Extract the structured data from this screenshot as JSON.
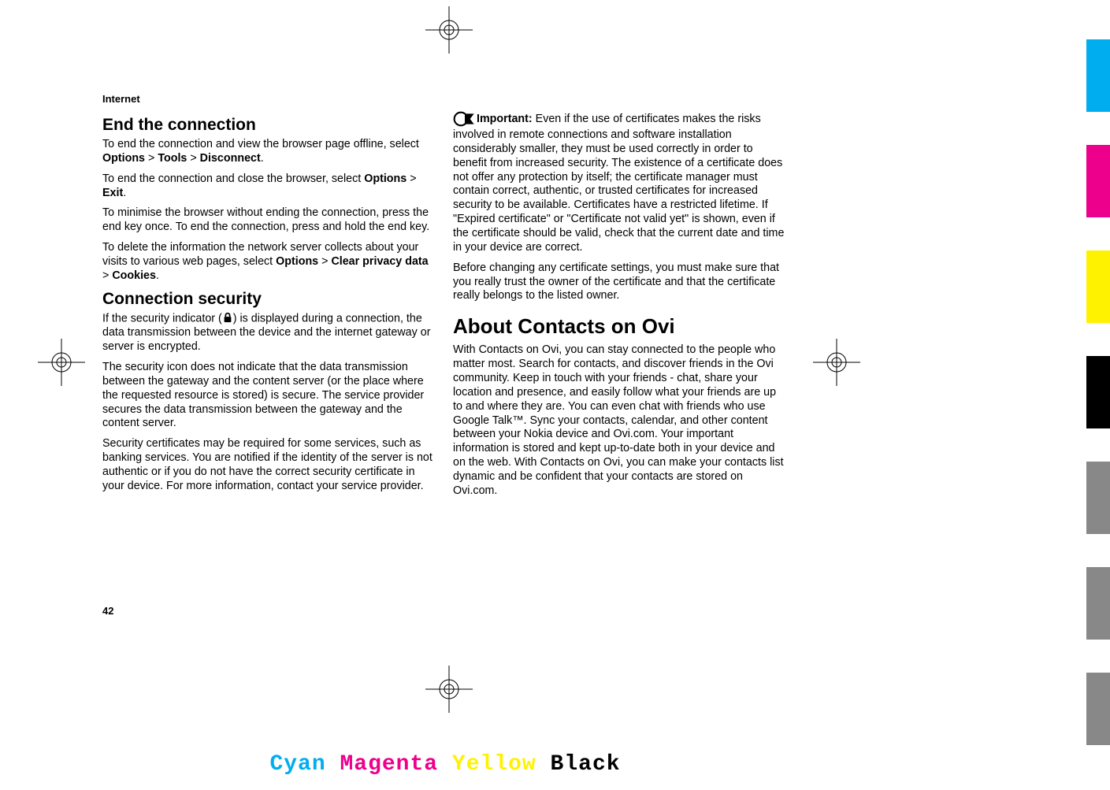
{
  "section": "Internet",
  "pageNumber": "42",
  "left": {
    "heading1": "End the connection",
    "p1a": "To end the connection and view the browser page offline, select ",
    "p1b": "Options",
    "p1c": " > ",
    "p1d": "Tools",
    "p1e": " > ",
    "p1f": "Disconnect",
    "p1g": ".",
    "p2a": "To end the connection and close the browser, select ",
    "p2b": "Options",
    "p2c": " > ",
    "p2d": "Exit",
    "p2e": ".",
    "p3": "To minimise the browser without ending the connection, press the end key once. To end the connection, press and hold the end key.",
    "p4a": "To delete the information the network server collects about your visits to various web pages, select ",
    "p4b": "Options",
    "p4c": " > ",
    "p4d": "Clear privacy data",
    "p4e": " > ",
    "p4f": "Cookies",
    "p4g": ".",
    "heading2": "Connection security",
    "p5a": "If the security indicator (",
    "p5b": ") is displayed during a connection, the data transmission between the device and the internet gateway or server is encrypted.",
    "p6": "The security icon does not indicate that the data transmission between the gateway and the content server (or the place where the requested resource is stored) is secure. The service provider secures the data transmission between the gateway and the content server.",
    "p7": "Security certificates may be required for some services, such as banking services. You are notified if the identity of the server is not authentic or if you do not have the correct security certificate in your device. For more information, contact your service provider."
  },
  "right": {
    "importantLabel": "Important:  ",
    "importantText": "Even if the use of certificates makes the risks involved in remote connections and software installation considerably smaller, they must be used correctly in order to benefit from increased security. The existence of a certificate does not offer any protection by itself; the certificate manager must contain correct, authentic, or trusted certificates for increased security to be available. Certificates have a restricted lifetime. If \"Expired certificate\" or \"Certificate not valid yet\" is shown, even if the certificate should be valid, check that the current date and time in your device are correct.",
    "p2": "Before changing any certificate settings, you must make sure that you really trust the owner of the certificate and that the certificate really belongs to the listed owner.",
    "heading1": "About Contacts on Ovi",
    "p3": "With Contacts on Ovi, you can stay connected to the people who matter most. Search for contacts, and discover friends in the Ovi community. Keep in touch with your friends - chat, share your location and presence, and easily follow what your friends are up to and where they are. You can even chat with friends who use Google Talk™. Sync your contacts, calendar, and other content between your Nokia device and Ovi.com. Your important information is stored and kept up-to-date both in your device and on the web. With Contacts on Ovi, you can make your contacts list dynamic and be confident that your contacts are stored on Ovi.com."
  },
  "colors": {
    "cyan": "Cyan",
    "magenta": "Magenta",
    "yellow": "Yellow",
    "black": "Black"
  },
  "swatches": [
    "#00AEEF",
    "#EC008C",
    "#FFF200",
    "#000000",
    "#888888",
    "#888888",
    "#888888"
  ]
}
